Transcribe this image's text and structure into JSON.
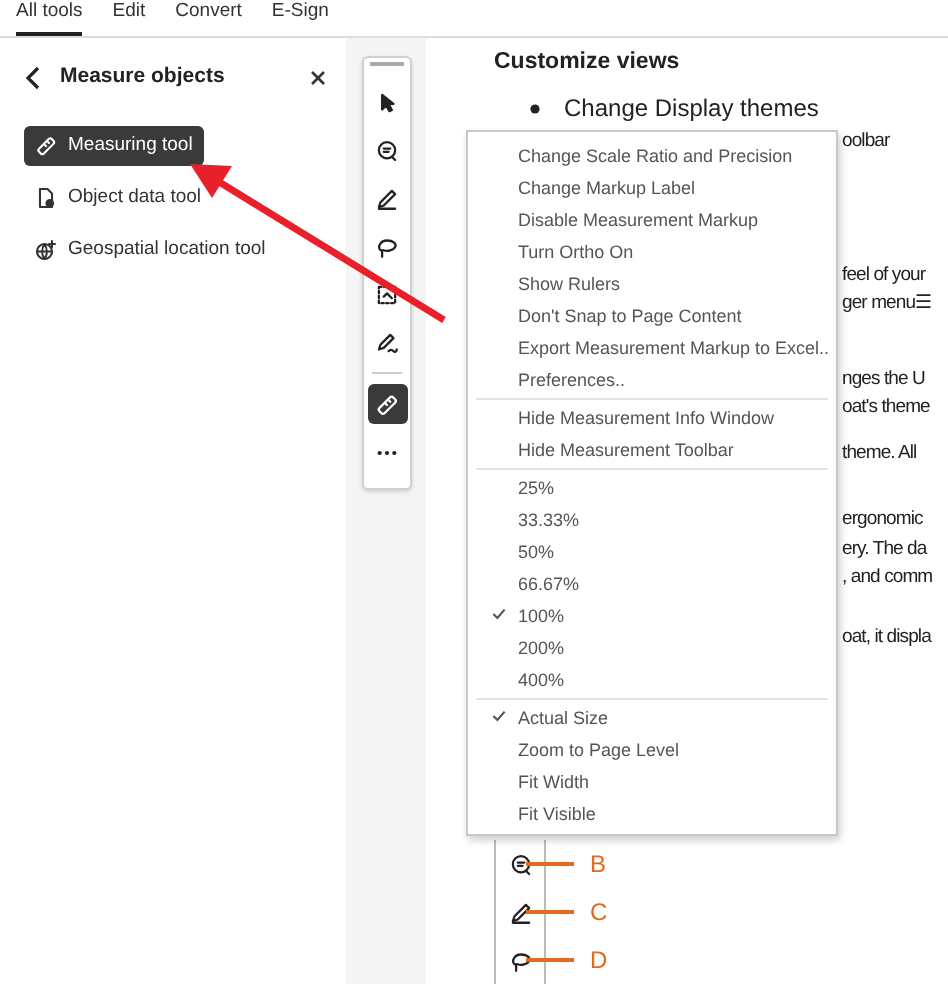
{
  "tabs": [
    {
      "label": "All tools",
      "selected": true
    },
    {
      "label": "Edit",
      "selected": false
    },
    {
      "label": "Convert",
      "selected": false
    },
    {
      "label": "E-Sign",
      "selected": false
    }
  ],
  "panel": {
    "title": "Measure objects",
    "items": [
      {
        "label": "Measuring tool",
        "kind": "ruler",
        "selected": true
      },
      {
        "label": "Object data tool",
        "kind": "data",
        "selected": false
      },
      {
        "label": "Geospatial location tool",
        "kind": "geo",
        "selected": false
      }
    ]
  },
  "toolbar": {
    "tools": [
      {
        "kind": "select",
        "selected": false
      },
      {
        "kind": "comment",
        "selected": false
      },
      {
        "kind": "pen",
        "selected": false
      },
      {
        "kind": "lasso",
        "selected": false
      },
      {
        "kind": "area",
        "selected": false
      },
      {
        "kind": "sign",
        "selected": false
      },
      {
        "kind": "ruler",
        "selected": true
      },
      {
        "kind": "more",
        "selected": false
      }
    ]
  },
  "document": {
    "lines": [
      {
        "kind": "heading",
        "text": "Customize views"
      },
      {
        "kind": "bullet",
        "text": "Change Display themes"
      },
      {
        "kind": "fragment",
        "text": "oolbar"
      },
      {
        "kind": "fragment",
        "text": "feel of your"
      },
      {
        "kind": "fragment",
        "text": "ger menu☰"
      },
      {
        "kind": "fragment",
        "text": "nges the U"
      },
      {
        "kind": "fragment",
        "text": "oat's theme"
      },
      {
        "kind": "fragment",
        "text": "theme. All"
      },
      {
        "kind": "fragment",
        "text": "ergonomic"
      },
      {
        "kind": "fragment",
        "text": "ery. The da"
      },
      {
        "kind": "fragment",
        "text": ", and comm"
      },
      {
        "kind": "fragment",
        "text": "oat, it displa"
      }
    ],
    "callouts": [
      {
        "label": "B",
        "kind": "comment"
      },
      {
        "label": "C",
        "kind": "pen"
      },
      {
        "label": "D",
        "kind": "lasso"
      }
    ]
  },
  "menu": {
    "groups": [
      {
        "items": [
          {
            "label": "Change Scale Ratio and Precision",
            "checked": false
          },
          {
            "label": "Change Markup Label",
            "checked": false
          },
          {
            "label": "Disable Measurement Markup",
            "checked": false
          },
          {
            "label": "Turn Ortho On",
            "checked": false
          },
          {
            "label": "Show Rulers",
            "checked": false
          },
          {
            "label": "Don't Snap to Page Content",
            "checked": false
          },
          {
            "label": "Export Measurement Markup to Excel..",
            "checked": false
          },
          {
            "label": "Preferences..",
            "checked": false
          }
        ]
      },
      {
        "items": [
          {
            "label": "Hide Measurement Info Window",
            "checked": false
          },
          {
            "label": "Hide Measurement Toolbar",
            "checked": false
          }
        ]
      },
      {
        "items": [
          {
            "label": "25%",
            "checked": false
          },
          {
            "label": "33.33%",
            "checked": false
          },
          {
            "label": "50%",
            "checked": false
          },
          {
            "label": "66.67%",
            "checked": false
          },
          {
            "label": "100%",
            "checked": true
          },
          {
            "label": "200%",
            "checked": false
          },
          {
            "label": "400%",
            "checked": false
          }
        ]
      },
      {
        "items": [
          {
            "label": "Actual Size",
            "checked": true
          },
          {
            "label": "Zoom to Page Level",
            "checked": false
          },
          {
            "label": "Fit Width",
            "checked": false
          },
          {
            "label": "Fit Visible",
            "checked": false
          }
        ]
      }
    ]
  }
}
